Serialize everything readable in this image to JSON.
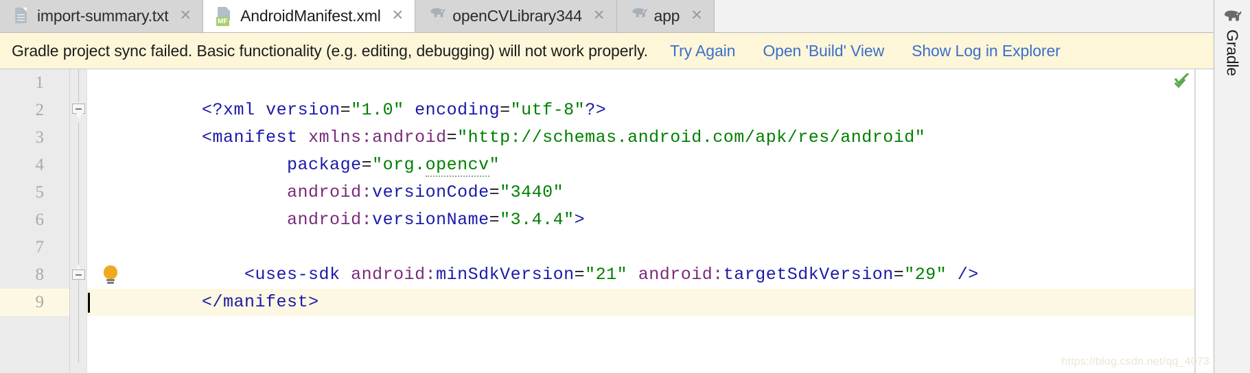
{
  "tabs": [
    {
      "label": "import-summary.txt",
      "icon": "text-file-icon",
      "active": false,
      "closable": true
    },
    {
      "label": "AndroidManifest.xml",
      "icon": "manifest-file-icon",
      "badge": "MF",
      "active": true,
      "closable": true
    },
    {
      "label": "openCVLibrary344",
      "icon": "gradle-elephant-icon",
      "active": false,
      "closable": true
    },
    {
      "label": "app",
      "icon": "gradle-elephant-icon",
      "active": false,
      "closable": true
    }
  ],
  "banner": {
    "message": "Gradle project sync failed. Basic functionality (e.g. editing, debugging) will not work properly.",
    "actions": [
      {
        "label": "Try Again"
      },
      {
        "label": "Open 'Build' View"
      },
      {
        "label": "Show Log in Explorer"
      }
    ],
    "background": "#fdf6d9",
    "link_color": "#3b6ecc"
  },
  "editor": {
    "line_numbers": [
      "1",
      "2",
      "3",
      "4",
      "5",
      "6",
      "7",
      "8",
      "9"
    ],
    "current_line": 9,
    "lines": [
      {
        "n": 1,
        "tokens": [
          {
            "t": "<?",
            "c": "punct"
          },
          {
            "t": "xml",
            "c": "pi"
          },
          {
            "t": " version",
            "c": "attr2"
          },
          {
            "t": "=",
            "c": "eq"
          },
          {
            "t": "\"1.0\"",
            "c": "val"
          },
          {
            "t": " encoding",
            "c": "attr2"
          },
          {
            "t": "=",
            "c": "eq"
          },
          {
            "t": "\"utf-8\"",
            "c": "val"
          },
          {
            "t": "?>",
            "c": "punct"
          }
        ]
      },
      {
        "n": 2,
        "tokens": [
          {
            "t": "<",
            "c": "punct"
          },
          {
            "t": "manifest",
            "c": "tag"
          },
          {
            "t": " xmlns:",
            "c": "attr"
          },
          {
            "t": "android",
            "c": "attr"
          },
          {
            "t": "=",
            "c": "eq"
          },
          {
            "t": "\"http://schemas.android.com/apk/res/android\"",
            "c": "val"
          }
        ]
      },
      {
        "n": 3,
        "indent": 8,
        "tokens": [
          {
            "t": "package",
            "c": "attr2"
          },
          {
            "t": "=",
            "c": "eq"
          },
          {
            "t": "\"org.",
            "c": "val"
          },
          {
            "t": "opencv",
            "c": "val-squiggle"
          },
          {
            "t": "\"",
            "c": "val"
          }
        ]
      },
      {
        "n": 4,
        "indent": 8,
        "tokens": [
          {
            "t": "android:",
            "c": "attr"
          },
          {
            "t": "versionCode",
            "c": "attr2"
          },
          {
            "t": "=",
            "c": "eq"
          },
          {
            "t": "\"3440\"",
            "c": "val"
          }
        ]
      },
      {
        "n": 5,
        "indent": 8,
        "tokens": [
          {
            "t": "android:",
            "c": "attr"
          },
          {
            "t": "versionName",
            "c": "attr2"
          },
          {
            "t": "=",
            "c": "eq"
          },
          {
            "t": "\"3.4.4\"",
            "c": "val"
          },
          {
            "t": ">",
            "c": "punct"
          }
        ]
      },
      {
        "n": 6,
        "tokens": []
      },
      {
        "n": 7,
        "indent": 4,
        "tokens": [
          {
            "t": "<",
            "c": "punct"
          },
          {
            "t": "uses-sdk",
            "c": "tag"
          },
          {
            "t": " android:",
            "c": "attr"
          },
          {
            "t": "minSdkVersion",
            "c": "attr2"
          },
          {
            "t": "=",
            "c": "eq"
          },
          {
            "t": "\"21\"",
            "c": "val"
          },
          {
            "t": " android:",
            "c": "attr"
          },
          {
            "t": "targetSdkVersion",
            "c": "attr2"
          },
          {
            "t": "=",
            "c": "eq"
          },
          {
            "t": "\"29\"",
            "c": "val"
          },
          {
            "t": " />",
            "c": "punct"
          }
        ]
      },
      {
        "n": 8,
        "tokens": [
          {
            "t": "</",
            "c": "punct"
          },
          {
            "t": "manifest",
            "c": "tag"
          },
          {
            "t": ">",
            "c": "punct"
          }
        ]
      },
      {
        "n": 9,
        "tokens": []
      }
    ],
    "fold_markers": [
      {
        "line": 2,
        "state": "expanded",
        "type": "top"
      },
      {
        "line": 8,
        "state": "expanded",
        "type": "bottom"
      }
    ],
    "intention_bulb": {
      "line": 8,
      "name": "intention-lightbulb"
    },
    "inspection_status": {
      "name": "inspection-ok-check",
      "color": "#59a84a"
    }
  },
  "toolstrip": {
    "label": "Gradle",
    "icon": "gradle-elephant-icon"
  },
  "watermark": "https://blog.csdn.net/qq_4073"
}
